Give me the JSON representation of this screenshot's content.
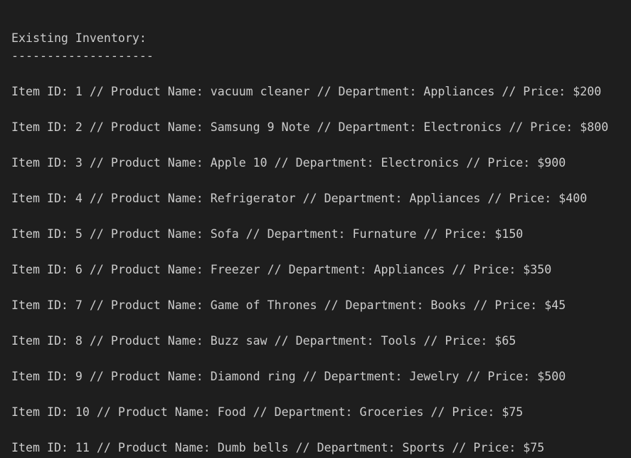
{
  "terminal": {
    "heading": "Existing Inventory:",
    "separator": "--------------------",
    "items": [
      "Item ID: 1 // Product Name: vacuum cleaner // Department: Appliances // Price: $200",
      "Item ID: 2 // Product Name: Samsung 9 Note // Department: Electronics // Price: $800",
      "Item ID: 3 // Product Name: Apple 10 // Department: Electronics // Price: $900",
      "Item ID: 4 // Product Name: Refrigerator // Department: Appliances // Price: $400",
      "Item ID: 5 // Product Name: Sofa // Department: Furnature // Price: $150",
      "Item ID: 6 // Product Name: Freezer // Department: Appliances // Price: $350",
      "Item ID: 7 // Product Name: Game of Thrones // Department: Books // Price: $45",
      "Item ID: 8 // Product Name: Buzz saw // Department: Tools // Price: $65",
      "Item ID: 9 // Product Name: Diamond ring // Department: Jewelry // Price: $500",
      "Item ID: 10 // Product Name: Food // Department: Groceries // Price: $75",
      "Item ID: 11 // Product Name: Dumb bells // Department: Sports // Price: $75"
    ]
  }
}
